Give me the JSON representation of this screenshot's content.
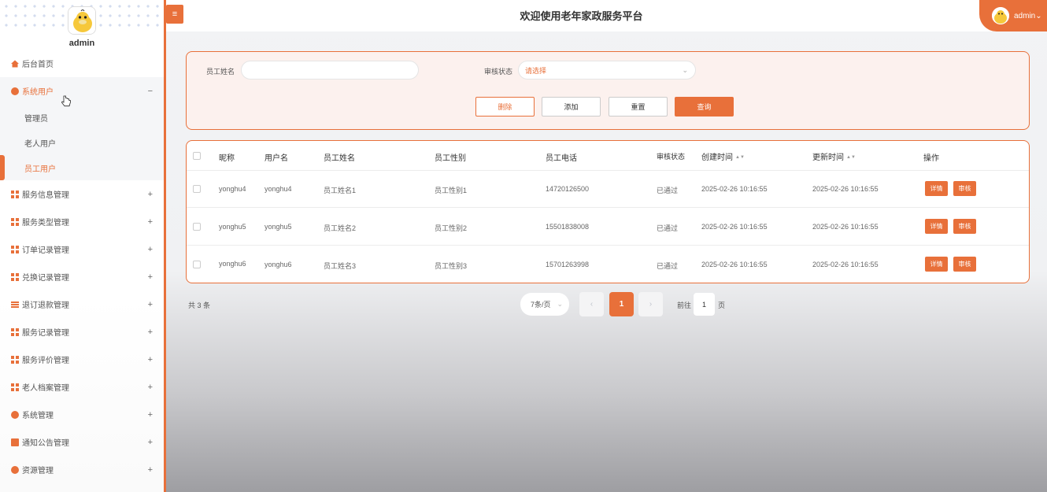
{
  "sidebar": {
    "username": "admin",
    "home": "后台首页",
    "open_group": "系统用户",
    "sub_items": [
      "管理员",
      "老人用户",
      "员工用户"
    ],
    "groups": [
      "服务信息管理",
      "服务类型管理",
      "订单记录管理",
      "兑换记录管理",
      "退订退款管理",
      "服务记录管理",
      "服务评价管理",
      "老人档案管理",
      "系统管理",
      "通知公告管理",
      "资源管理"
    ],
    "expand_symbol": "+",
    "collapse_symbol": "−"
  },
  "header": {
    "menu_toggle": "≡",
    "title": "欢迎使用老年家政服务平台",
    "user": "admin",
    "user_caret": "⌄"
  },
  "search": {
    "name_label": "员工姓名",
    "name_value": "",
    "status_label": "审核状态",
    "status_placeholder": "请选择",
    "status_caret": "⌄",
    "buttons": {
      "delete": "删除",
      "add": "添加",
      "reset": "重置",
      "query": "查询"
    }
  },
  "table": {
    "headers": [
      "昵称",
      "用户名",
      "员工姓名",
      "员工性别",
      "员工电话",
      "审核状态",
      "创建时间",
      "更新时间",
      "操作"
    ],
    "sort_symbol": "▲▼",
    "rows": [
      {
        "nickname": "yonghu4",
        "username": "yonghu4",
        "name": "员工姓名1",
        "gender": "员工性别1",
        "phone": "14720126500",
        "status": "已通过",
        "created": "2025-02-26 10:16:55",
        "updated": "2025-02-26 10:16:55"
      },
      {
        "nickname": "yonghu5",
        "username": "yonghu5",
        "name": "员工姓名2",
        "gender": "员工性别2",
        "phone": "15501838008",
        "status": "已通过",
        "created": "2025-02-26 10:16:55",
        "updated": "2025-02-26 10:16:55"
      },
      {
        "nickname": "yonghu6",
        "username": "yonghu6",
        "name": "员工姓名3",
        "gender": "员工性别3",
        "phone": "15701263998",
        "status": "已通过",
        "created": "2025-02-26 10:16:55",
        "updated": "2025-02-26 10:16:55"
      }
    ],
    "actions": {
      "detail": "详情",
      "review": "审核"
    }
  },
  "pagination": {
    "total": "共 3 条",
    "page_size": "7条/页",
    "page_size_caret": "⌄",
    "prev": "‹",
    "current": "1",
    "next": "›",
    "goto_prefix": "前往",
    "goto_value": "1",
    "goto_suffix": "页"
  },
  "colors": {
    "accent": "#e8703a",
    "panel_bg": "#fcf1ee"
  }
}
